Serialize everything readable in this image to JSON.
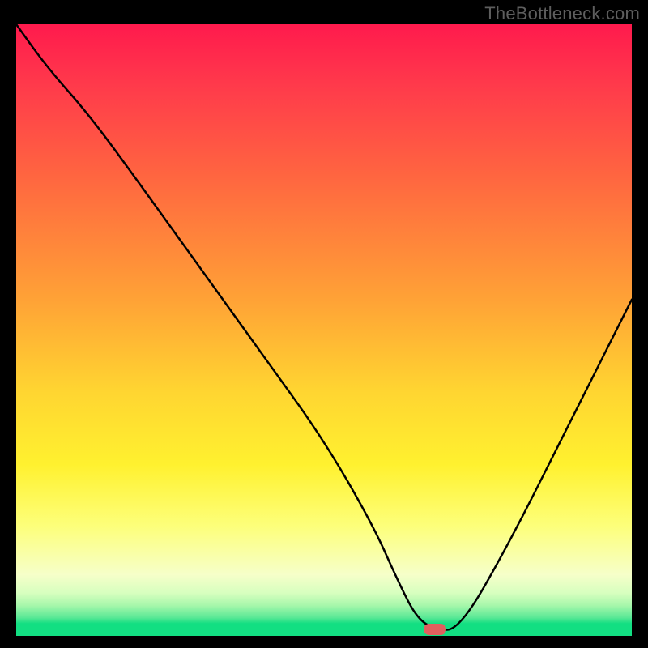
{
  "watermark": "TheBottleneck.com",
  "chart_data": {
    "type": "line",
    "title": "",
    "xlabel": "",
    "ylabel": "",
    "xlim": [
      0,
      100
    ],
    "ylim": [
      0,
      100
    ],
    "x": [
      0,
      5,
      12,
      20,
      30,
      40,
      50,
      58,
      62,
      65,
      68,
      72,
      80,
      90,
      100
    ],
    "values": [
      100,
      93,
      85,
      74,
      60,
      46,
      32,
      18,
      9,
      3,
      1,
      1,
      15,
      35,
      55
    ],
    "marker": {
      "x": 68,
      "y": 1
    },
    "background": "red-to-green vertical gradient",
    "annotations": []
  },
  "colors": {
    "curve": "#000000",
    "marker": "#e15f5e",
    "frame": "#000000"
  }
}
